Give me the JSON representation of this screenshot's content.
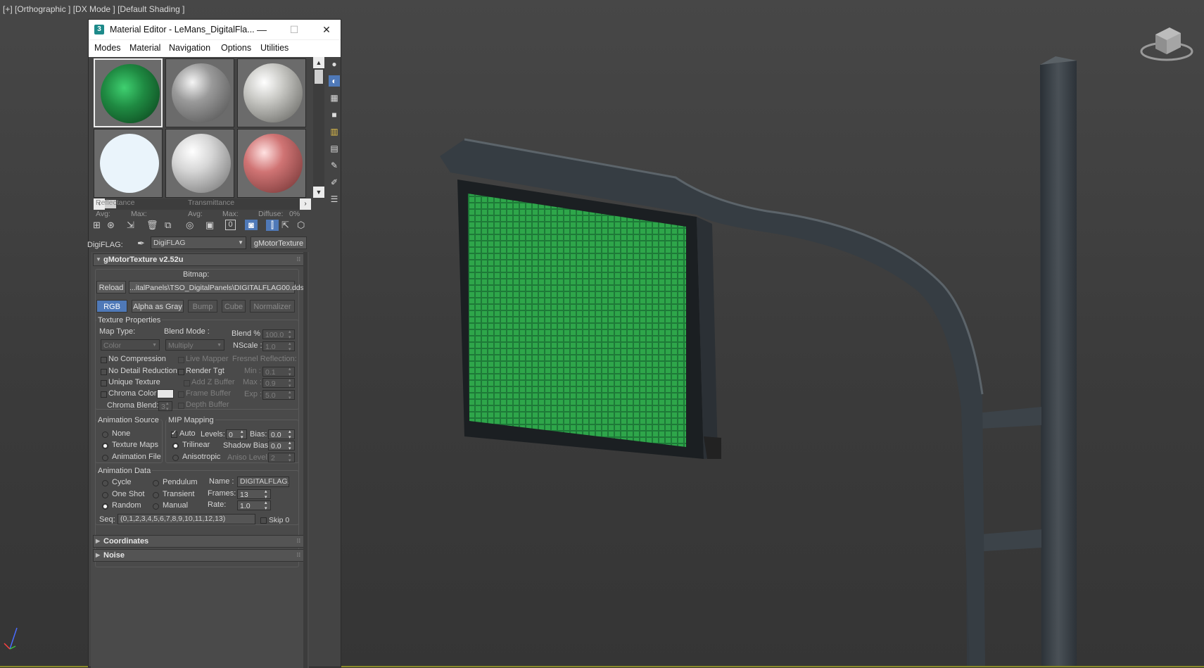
{
  "viewport": {
    "label": "[+] [Orthographic ] [DX Mode ] [Default Shading ]"
  },
  "colors": {
    "viewport_bg": "#3e3e3e",
    "led_green": "#2ea64a",
    "selection_blue": "#4f79b8"
  },
  "editor": {
    "title": "Material Editor - LeMans_DigitalFla...",
    "app_icon": "3",
    "window_buttons": {
      "minimize": "—",
      "maximize": "☐",
      "close": "✕"
    },
    "menu": [
      "Modes",
      "Material",
      "Navigation",
      "Options",
      "Utilities"
    ],
    "slots": [
      {
        "name": "digiflag-slot",
        "active": true
      },
      {
        "name": "gray-slot",
        "active": false
      },
      {
        "name": "gray-light-slot",
        "active": false
      },
      {
        "name": "white-slot",
        "active": false
      },
      {
        "name": "silver-slot",
        "active": false
      },
      {
        "name": "red-slot",
        "active": false
      }
    ],
    "reflectance": {
      "label": "Reflectance",
      "avg": "Avg:",
      "max": "Max:"
    },
    "transmittance": {
      "label": "Transmittance",
      "avg": "Avg:",
      "max": "Max:",
      "diffuse": "Diffuse:",
      "diffuse_value": "0%"
    },
    "material_name_label": "DigiFLAG:",
    "material_name_value": "DigiFLAG",
    "material_type": "gMotorTexture",
    "rollout_main": "gMotorTexture v2.52u",
    "bitmap": {
      "label": "Bitmap:",
      "reload": "Reload",
      "path": "...italPanels\\TSO_DigitalPanels\\DIGITALFLAG00.dds",
      "channels": [
        "RGB",
        "Alpha as Gray",
        "Bump",
        "Cube",
        "Normalizer"
      ]
    },
    "texture_properties": {
      "title": "Texture Properties",
      "map_type_label": "Map Type:",
      "map_type_value": "Color",
      "blend_mode_label": "Blend Mode :",
      "blend_mode_value": "Multiply",
      "blend_pct_label": "Blend % :",
      "blend_pct_value": "100.0",
      "nscale_label": "NScale :",
      "nscale_value": "1.0",
      "no_compression": "No Compression",
      "no_detail_reduction": "No Detail Reduction",
      "unique_texture": "Unique Texture",
      "chroma_color": "Chroma Color:",
      "chroma_blend": "Chroma Blend:",
      "chroma_blend_value": "3",
      "live_mapper": "Live Mapper",
      "render_tgt": "Render Tgt",
      "add_z_buffer": "Add Z Buffer",
      "frame_buffer": "Frame Buffer",
      "depth_buffer": "Depth Buffer",
      "fresnel_label": "Fresnel Reflection:",
      "min_label": "Min :",
      "min_value": "0.1",
      "max_label": "Max :",
      "max_value": "0.9",
      "exp_label": "Exp :",
      "exp_value": "5.0"
    },
    "animation_source": {
      "title": "Animation Source",
      "options": [
        "None",
        "Texture Maps",
        "Animation File"
      ],
      "selected": "Texture Maps"
    },
    "mip_mapping": {
      "title": "MIP Mapping",
      "auto": "Auto",
      "levels_label": "Levels:",
      "levels_value": "0",
      "bias_label": "Bias:",
      "bias_value": "0.0",
      "trilinear": "Trilinear",
      "shadow_bias_label": "Shadow Bias:",
      "shadow_bias_value": "0.0",
      "anisotropic": "Anisotropic",
      "aniso_label": "Aniso Level:",
      "aniso_value": "2"
    },
    "animation_data": {
      "title": "Animation Data",
      "modes": [
        "Cycle",
        "One Shot",
        "Random",
        "Pendulum",
        "Transient",
        "Manual"
      ],
      "selected": "Random",
      "name_label": "Name :",
      "name_value": "DIGITALFLAG.dc",
      "frames_label": "Frames:",
      "frames_value": "13",
      "rate_label": "Rate:",
      "rate_value": "1.0",
      "seq_label": "Seq:",
      "seq_value": "(0,1,2,3,4,5,6,7,8,9,10,11,12,13)",
      "skip_label": "Skip 0"
    },
    "rollout_coordinates": "Coordinates",
    "rollout_noise": "Noise"
  }
}
